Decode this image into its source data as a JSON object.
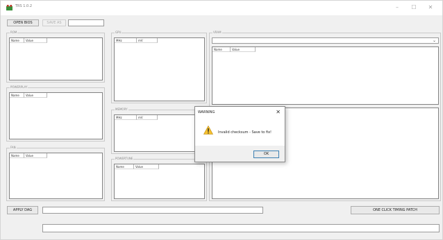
{
  "window": {
    "title": "TRS 1.0.2",
    "controls": {
      "minimize": "–",
      "maximize": "☐",
      "close": "✕"
    }
  },
  "toolbar": {
    "open_bios": "OPEN BIOS",
    "save_as": "SAVE AS"
  },
  "groups": {
    "rom": {
      "label": "ROM",
      "columns": [
        "Name",
        "Value"
      ]
    },
    "powerplay": {
      "label": "POWERPLAY",
      "columns": [
        "Name",
        "Value"
      ]
    },
    "fan": {
      "label": "FAN",
      "columns": [
        "Name",
        "Value"
      ]
    },
    "gpu": {
      "label": "GPU",
      "columns": [
        "MHz",
        "mV"
      ]
    },
    "memory": {
      "label": "MEMORY",
      "columns": [
        "MHz",
        "mV"
      ]
    },
    "powertune": {
      "label": "POWERTUNE",
      "columns": [
        "Name",
        "Value"
      ]
    },
    "vram": {
      "label": "VRAM",
      "columns": [
        "Name",
        "Value"
      ]
    }
  },
  "bottom": {
    "apply_dag": "APPLY DAG",
    "one_click": "ONE CLICK TIMING PATCH"
  },
  "dialog": {
    "title": "WARNING",
    "close": "✕",
    "message": "Invalid checksum - Save to fix!",
    "ok": "OK"
  },
  "icons": {
    "app": "app-icon",
    "warning": "warning-icon"
  },
  "colors": {
    "window_bg": "#f0f0f0",
    "warning_yellow": "#f6c12f"
  }
}
